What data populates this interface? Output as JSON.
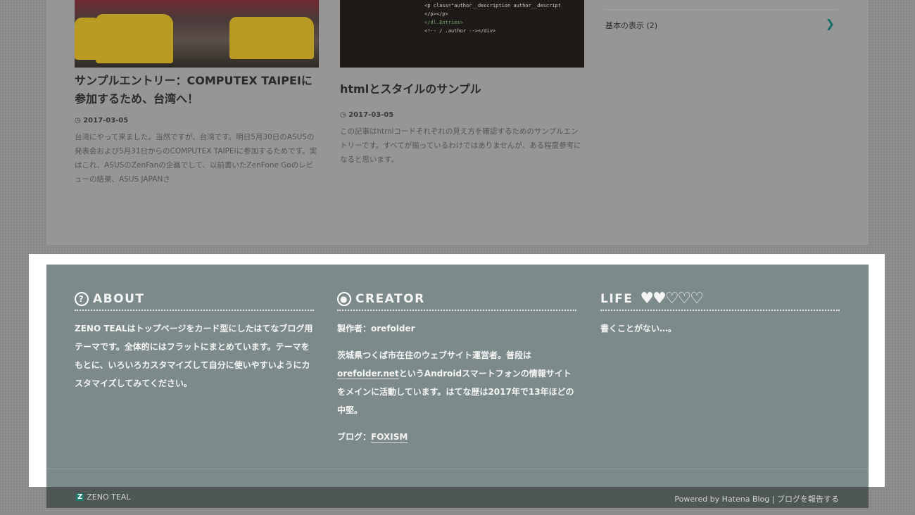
{
  "posts": [
    {
      "title": "サンプルエントリー：COMPUTEX TAIPEIに参加するため、台湾へ！",
      "date": "2017-03-05",
      "excerpt": "台湾にやって来ました。当然ですが、台湾です。明日5月30日のASUSの発表会および5月31日からのCOMPUTEX TAIPEIに参加するためです。実はこれ、ASUSのZenFanの企画でして、以前書いたZenFone Goのレビューの結果、ASUS JAPANさ"
    },
    {
      "title": "htmlとスタイルのサンプル",
      "date": "2017-03-05",
      "excerpt": "この記事はhtmlコードそれぞれの見え方を確認するためのサンプルエントリーです。すべてが揃っているわけではありませんが、ある程度参考になると思います。",
      "code": [
        "<p class=\"author__description author__descript",
        "</p></p>",
        "</dl.Entries>",
        "<!-- / .author --></div>"
      ]
    }
  ],
  "sidebar": {
    "item": "基本の表示 (2)"
  },
  "footer": {
    "about": {
      "title": "ABOUT",
      "text": "ZENO TEALはトップページをカード型にしたはてなブログ用テーマです。全体的にはフラットにまとめています。テーマをもとに、いろいろカスタマイズして自分に使いやすいようにカスタマイズしてみてください。"
    },
    "creator": {
      "title": "CREATOR",
      "author_label": "製作者：",
      "author": "orefolder",
      "desc_pre": "茨城県つくば市在住のウェブサイト運営者。普段は",
      "desc_link": "orefolder.net",
      "desc_post": "というAndroidスマートフォンの情報サイトをメインに活動しています。はてな歴は2017年で13年ほどの中堅。",
      "blog_label": "ブログ：",
      "blog": "FOXISM"
    },
    "life": {
      "title": "LIFE",
      "hearts": "♥♥♡♡♡",
      "hearts_filled": 2,
      "hearts_total": 5,
      "text": "書くことがない…。"
    }
  },
  "bottom": {
    "logo_letter": "Z",
    "logo": "ZENO TEAL",
    "powered": "Powered by Hatena Blog | ブログを報告する"
  }
}
